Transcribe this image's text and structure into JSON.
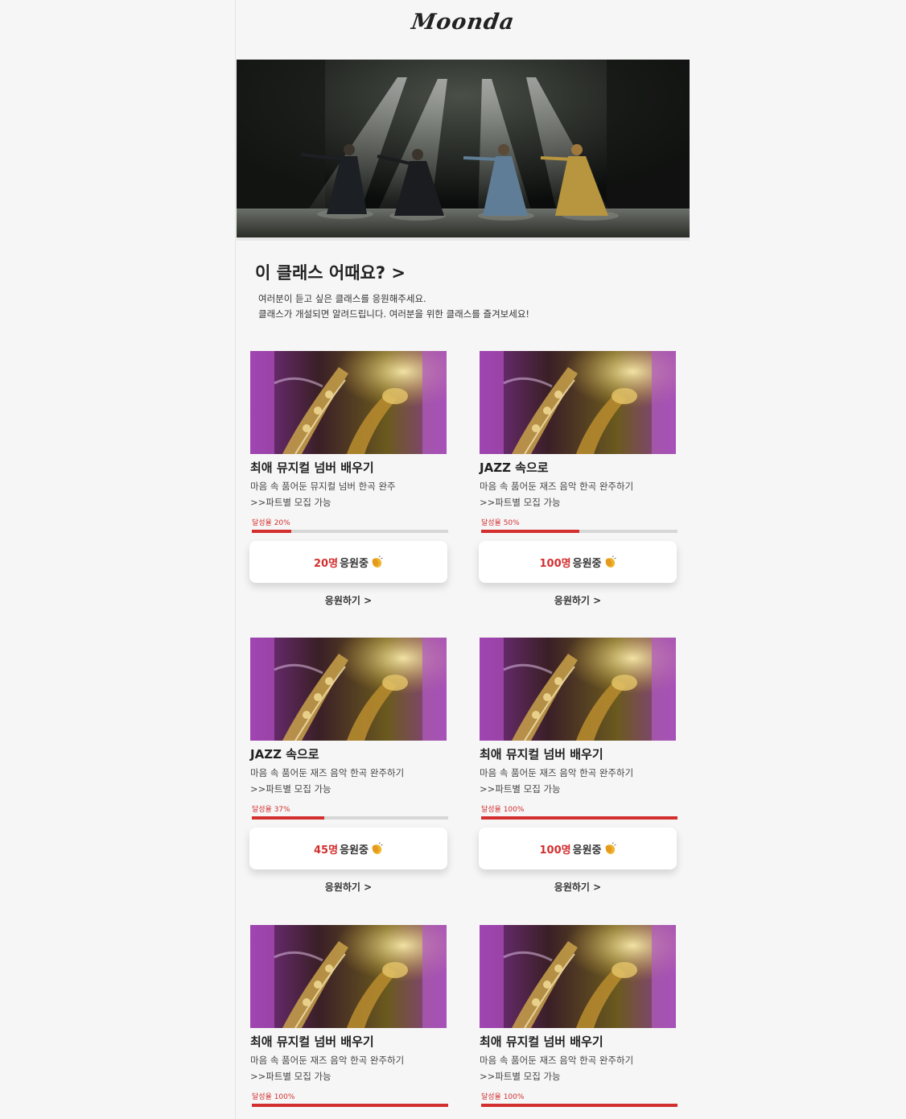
{
  "header": {
    "logo": "Moonda"
  },
  "hero": {
    "image": "musical-stage-photo"
  },
  "section": {
    "title": "이 클래스 어때요? >",
    "desc_line1": "여러분이 듣고 싶은 클래스를 응원해주세요.",
    "desc_line2": "클래스가 개설되면 알려드립니다. 여러분을 위한 클래스를 즐겨보세요!"
  },
  "cards": [
    {
      "title": "최애 뮤지컬 넘버 배우기",
      "desc": "마음 속 품어둔 뮤지컬 넘버 한곡 완주",
      "recruit": ">>파트별 모집 가능",
      "rate_label": "달성율 20%",
      "rate": 20,
      "count": "20명",
      "supporting": "응원중",
      "link": "응원하기 >"
    },
    {
      "title": "JAZZ 속으로",
      "desc": "마음 속 품어둔 재즈 음악 한곡 완주하기",
      "recruit": ">>파트별 모집 가능",
      "rate_label": "달성율 50%",
      "rate": 50,
      "count": "100명",
      "supporting": "응원중",
      "link": "응원하기 >"
    },
    {
      "title": "JAZZ 속으로",
      "desc": "마음 속 품어둔 재즈 음악 한곡 완주하기",
      "recruit": ">>파트별 모집 가능",
      "rate_label": "달성율 37%",
      "rate": 37,
      "count": "45명",
      "supporting": "응원중",
      "link": "응원하기 >"
    },
    {
      "title": "최애 뮤지컬 넘버 배우기",
      "desc": "마음 속 품어둔 재즈 음악 한곡 완주하기",
      "recruit": ">>파트별 모집 가능",
      "rate_label": "달성율 100%",
      "rate": 100,
      "count": "100명",
      "supporting": "응원중",
      "link": "응원하기 >"
    },
    {
      "title": "최애 뮤지컬 넘버 배우기",
      "desc": "마음 속 품어둔 재즈 음악 한곡 완주하기",
      "recruit": ">>파트별 모집 가능",
      "rate_label": "달성율 100%",
      "rate": 100
    },
    {
      "title": "최애 뮤지컬 넘버 배우기",
      "desc": "마음 속 품어둔 재즈 음악 한곡 완주하기",
      "recruit": ">>파트별 모집 가능",
      "rate_label": "달성율 100%",
      "rate": 100
    }
  ],
  "colors": {
    "accent": "#d32f2f",
    "track": "#d7d7d7",
    "background": "#f6f6f6"
  }
}
